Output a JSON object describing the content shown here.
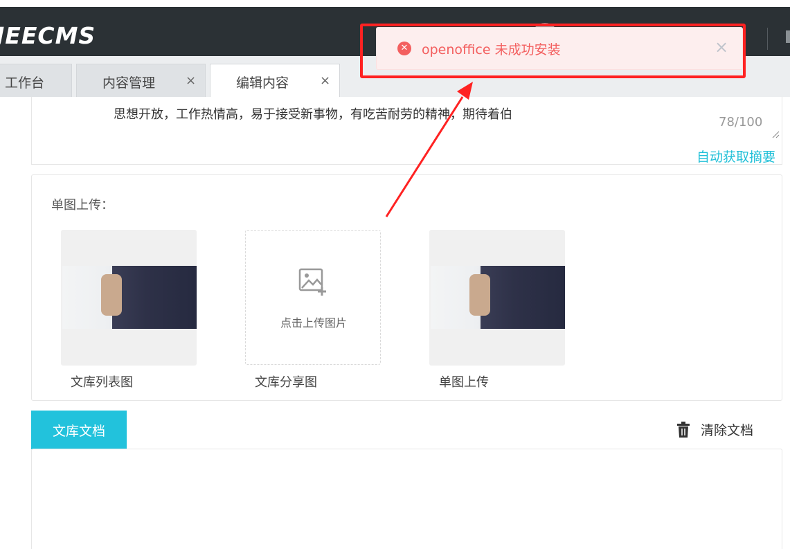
{
  "header": {
    "logo": "JEECMS"
  },
  "tabs": [
    {
      "label": "工作台",
      "closable": false,
      "active": false
    },
    {
      "label": "内容管理",
      "closable": true,
      "active": false
    },
    {
      "label": "编辑内容",
      "closable": true,
      "active": true
    }
  ],
  "tab_close_glyph": "×",
  "summary": {
    "text": "思想开放，工作热情高，易于接受新事物，有吃苦耐劳的精神，期待着伯",
    "counter": "78/100",
    "auto_link": "自动获取摘要"
  },
  "images": {
    "section_label": "单图上传：",
    "upload_hint": "点击上传图片",
    "captions": [
      "文库列表图",
      "文库分享图",
      "单图上传"
    ]
  },
  "documents": {
    "tab_label": "文库文档",
    "clear_label": "清除文档"
  },
  "toast": {
    "message": "openoffice 未成功安装",
    "icon": "error-circle-icon",
    "close_glyph": "×"
  },
  "colors": {
    "header_bg": "#2b3135",
    "accent": "#22c2dc",
    "error": "#f35f5f",
    "annotation": "#ff2222"
  }
}
